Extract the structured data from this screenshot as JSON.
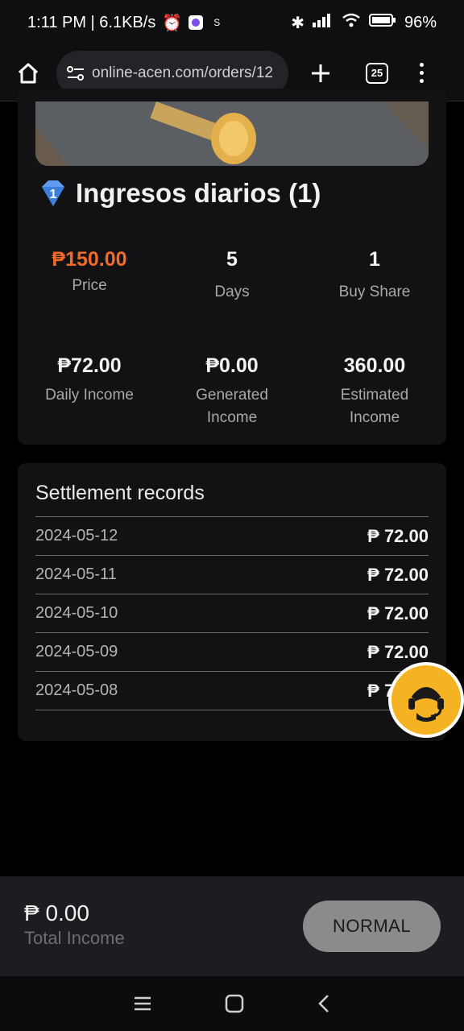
{
  "status": {
    "time_speed": "1:11 PM | 6.1KB/s",
    "battery": "96%",
    "mini_s": "S"
  },
  "browser": {
    "url": "online-acen.com/orders/12",
    "tab_count": "25"
  },
  "product": {
    "badge_number": "1",
    "title": "Ingresos diarios (1)",
    "stats": [
      {
        "value": "₱150.00",
        "label": "Price"
      },
      {
        "value": "5",
        "label": "Days"
      },
      {
        "value": "1",
        "label": "Buy Share"
      },
      {
        "value": "₱72.00",
        "label": "Daily Income"
      },
      {
        "value": "₱0.00",
        "label": "Generated Income"
      },
      {
        "value": "360.00",
        "label": "Estimated Income"
      }
    ]
  },
  "records": {
    "title": "Settlement records",
    "rows": [
      {
        "date": "2024-05-12",
        "amount": "₱ 72.00"
      },
      {
        "date": "2024-05-11",
        "amount": "₱ 72.00"
      },
      {
        "date": "2024-05-10",
        "amount": "₱ 72.00"
      },
      {
        "date": "2024-05-09",
        "amount": "₱ 72.00"
      },
      {
        "date": "2024-05-08",
        "amount": "₱ 72.00"
      }
    ]
  },
  "footer": {
    "total_value": "₱ 0.00",
    "total_label": "Total Income",
    "button_label": "NORMAL"
  },
  "colors": {
    "accent": "#f06a2a",
    "fab": "#f5b324"
  }
}
